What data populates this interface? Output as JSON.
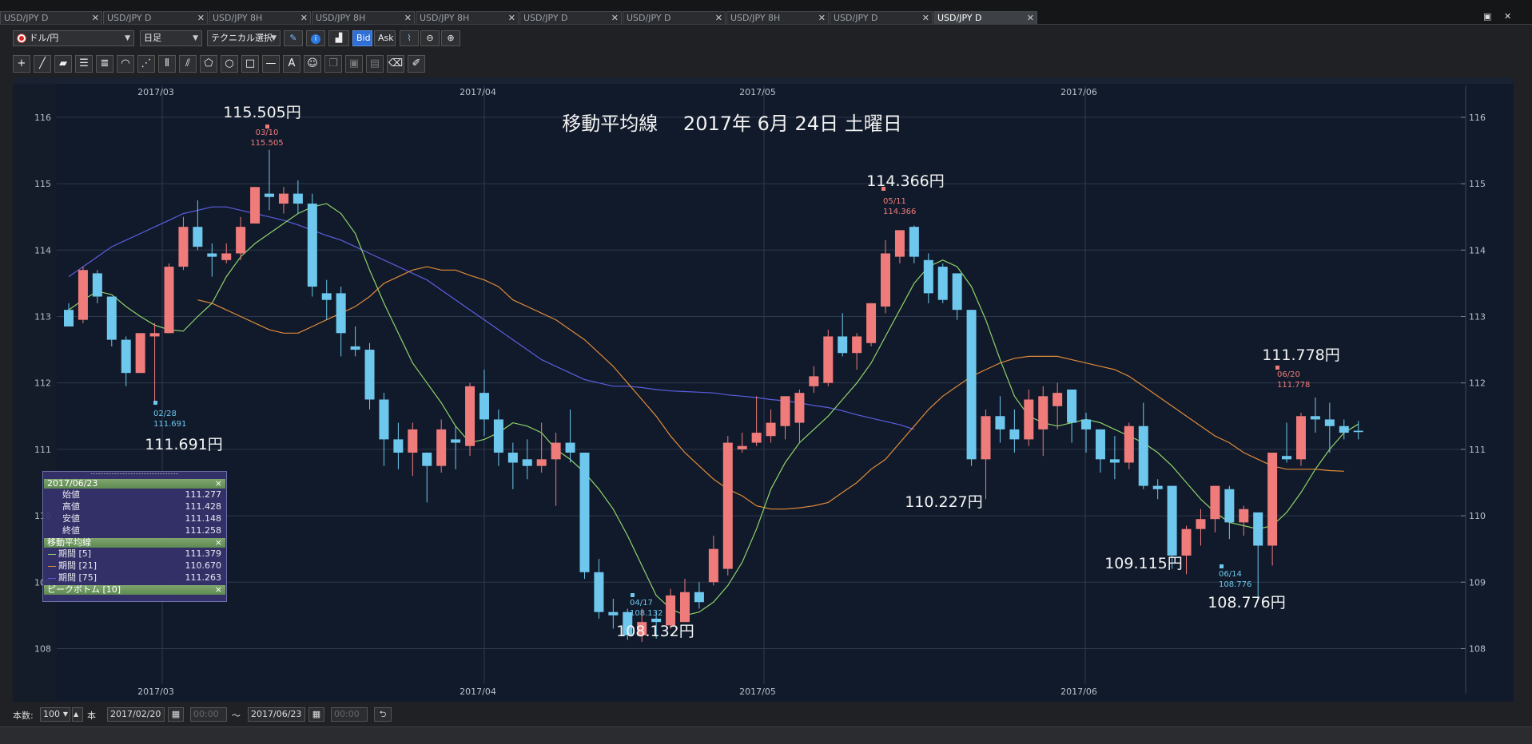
{
  "tabs": [
    {
      "label": "USD/JPY D",
      "x": 0,
      "w": 128,
      "active": false
    },
    {
      "label": "USD/JPY D",
      "x": 129,
      "w": 131,
      "active": false
    },
    {
      "label": "USD/JPY 8H",
      "x": 261,
      "w": 128,
      "active": false
    },
    {
      "label": "USD/JPY 8H",
      "x": 390,
      "w": 129,
      "active": false
    },
    {
      "label": "USD/JPY 8H",
      "x": 520,
      "w": 129,
      "active": false
    },
    {
      "label": "USD/JPY D",
      "x": 650,
      "w": 128,
      "active": false
    },
    {
      "label": "USD/JPY D",
      "x": 779,
      "w": 129,
      "active": false
    },
    {
      "label": "USD/JPY 8H",
      "x": 909,
      "w": 128,
      "active": false
    },
    {
      "label": "USD/JPY D",
      "x": 1038,
      "w": 129,
      "active": false
    },
    {
      "label": "USD/JPY D",
      "x": 1168,
      "w": 130,
      "active": true
    }
  ],
  "toolbar": {
    "pair": "ドル/円",
    "timeframe": "日足",
    "technical": "テクニカル選択",
    "bid": "Bid",
    "ask": "Ask"
  },
  "chart": {
    "title": "移動平均線　 2017年 6月 24日 土曜日",
    "months": [
      {
        "label": "2017/03",
        "x": 187
      },
      {
        "label": "2017/04",
        "x": 590
      },
      {
        "label": "2017/05",
        "x": 940
      },
      {
        "label": "2017/06",
        "x": 1342
      }
    ],
    "yticks": [
      116,
      115,
      114,
      113,
      112,
      111,
      110,
      109,
      108
    ],
    "y_axis_range": [
      107.2,
      116.6
    ]
  },
  "chart_data": {
    "type": "candlestick",
    "title": "移動平均線　 2017年 6月 24日 土曜日",
    "x_range": [
      "2017/02/20",
      "2017/06/23"
    ],
    "y_axis_range": [
      107.2,
      116.6
    ],
    "candles": [
      [
        113.1,
        112.85,
        113.2,
        112.85
      ],
      [
        112.95,
        113.7,
        113.75,
        112.9
      ],
      [
        113.65,
        113.3,
        113.7,
        113.2
      ],
      [
        113.3,
        112.65,
        113.3,
        112.55
      ],
      [
        112.65,
        112.15,
        112.7,
        111.95
      ],
      [
        112.15,
        112.75,
        112.75,
        112.15
      ],
      [
        112.7,
        112.75,
        112.9,
        111.7
      ],
      [
        112.75,
        113.75,
        113.8,
        112.75
      ],
      [
        113.75,
        114.35,
        114.5,
        113.7
      ],
      [
        114.35,
        114.05,
        114.75,
        114.0
      ],
      [
        113.95,
        113.9,
        114.1,
        113.6
      ],
      [
        113.85,
        113.95,
        114.1,
        113.8
      ],
      [
        113.95,
        114.35,
        114.5,
        113.85
      ],
      [
        114.4,
        114.95,
        114.95,
        114.4
      ],
      [
        114.85,
        114.8,
        115.51,
        114.6
      ],
      [
        114.7,
        114.85,
        114.95,
        114.55
      ],
      [
        114.85,
        114.7,
        115.05,
        114.55
      ],
      [
        114.7,
        113.45,
        114.85,
        113.3
      ],
      [
        113.35,
        113.25,
        113.55,
        112.95
      ],
      [
        113.35,
        112.75,
        113.45,
        112.4
      ],
      [
        112.55,
        112.5,
        112.85,
        112.4
      ],
      [
        112.5,
        111.75,
        112.6,
        111.6
      ],
      [
        111.75,
        111.15,
        111.85,
        110.75
      ],
      [
        111.15,
        110.95,
        111.4,
        110.7
      ],
      [
        110.95,
        111.3,
        111.4,
        110.6
      ],
      [
        110.95,
        110.75,
        110.95,
        110.2
      ],
      [
        110.75,
        111.3,
        111.45,
        110.65
      ],
      [
        111.15,
        111.1,
        111.35,
        110.7
      ],
      [
        111.05,
        111.95,
        112.0,
        110.9
      ],
      [
        111.85,
        111.45,
        112.2,
        111.2
      ],
      [
        111.45,
        110.95,
        111.6,
        110.75
      ],
      [
        110.95,
        110.8,
        111.1,
        110.4
      ],
      [
        110.85,
        110.75,
        111.15,
        110.55
      ],
      [
        110.75,
        110.85,
        111.4,
        110.65
      ],
      [
        110.85,
        111.1,
        111.25,
        110.15
      ],
      [
        111.1,
        110.95,
        111.6,
        110.8
      ],
      [
        110.95,
        109.15,
        110.95,
        109.05
      ],
      [
        109.15,
        108.55,
        109.35,
        108.45
      ],
      [
        108.55,
        108.5,
        108.75,
        108.3
      ],
      [
        108.55,
        108.2,
        108.6,
        108.13
      ],
      [
        108.2,
        108.4,
        108.6,
        108.1
      ],
      [
        108.45,
        108.4,
        108.55,
        108.15
      ],
      [
        108.35,
        108.8,
        108.9,
        108.3
      ],
      [
        108.4,
        108.85,
        109.05,
        108.4
      ],
      [
        108.85,
        108.7,
        109.0,
        108.6
      ],
      [
        109.0,
        109.5,
        109.7,
        108.95
      ],
      [
        109.2,
        111.1,
        111.2,
        109.1
      ],
      [
        111.0,
        111.05,
        111.25,
        110.95
      ],
      [
        111.1,
        111.25,
        111.8,
        111.05
      ],
      [
        111.2,
        111.4,
        111.6,
        111.1
      ],
      [
        111.35,
        111.8,
        111.8,
        111.15
      ],
      [
        111.4,
        111.85,
        111.9,
        111.1
      ],
      [
        111.95,
        112.1,
        112.25,
        111.85
      ],
      [
        112.0,
        112.7,
        112.8,
        111.95
      ],
      [
        112.7,
        112.45,
        113.05,
        112.4
      ],
      [
        112.45,
        112.7,
        112.75,
        112.2
      ],
      [
        112.6,
        113.2,
        113.2,
        112.55
      ],
      [
        113.15,
        113.95,
        114.15,
        113.05
      ],
      [
        113.9,
        114.3,
        114.3,
        113.8
      ],
      [
        114.35,
        113.9,
        114.37,
        113.8
      ],
      [
        113.85,
        113.35,
        113.95,
        113.2
      ],
      [
        113.75,
        113.25,
        113.8,
        113.2
      ],
      [
        113.65,
        113.1,
        113.65,
        112.95
      ],
      [
        113.1,
        110.85,
        113.1,
        110.75
      ],
      [
        110.85,
        111.5,
        111.6,
        110.25
      ],
      [
        111.5,
        111.3,
        111.8,
        111.1
      ],
      [
        111.3,
        111.15,
        111.6,
        110.95
      ],
      [
        111.15,
        111.75,
        111.9,
        111.05
      ],
      [
        111.3,
        111.8,
        111.95,
        110.9
      ],
      [
        111.65,
        111.85,
        112.0,
        111.3
      ],
      [
        111.9,
        111.4,
        111.9,
        111.1
      ],
      [
        111.45,
        111.3,
        111.55,
        110.95
      ],
      [
        111.3,
        110.85,
        111.3,
        110.65
      ],
      [
        110.85,
        110.8,
        111.2,
        110.55
      ],
      [
        110.8,
        111.35,
        111.4,
        110.7
      ],
      [
        111.35,
        110.45,
        111.7,
        110.4
      ],
      [
        110.45,
        110.4,
        110.55,
        110.25
      ],
      [
        110.45,
        109.4,
        110.45,
        109.2
      ],
      [
        109.4,
        109.8,
        109.85,
        109.12
      ],
      [
        109.8,
        109.95,
        110.1,
        109.55
      ],
      [
        109.95,
        110.45,
        110.45,
        109.75
      ],
      [
        110.4,
        109.9,
        110.45,
        109.65
      ],
      [
        109.9,
        110.1,
        110.15,
        109.7
      ],
      [
        110.05,
        109.55,
        110.05,
        108.78
      ],
      [
        109.55,
        110.95,
        110.95,
        109.25
      ],
      [
        110.9,
        110.85,
        111.4,
        110.8
      ],
      [
        110.85,
        111.5,
        111.55,
        110.75
      ],
      [
        111.5,
        111.45,
        111.78,
        111.25
      ],
      [
        111.45,
        111.35,
        111.7,
        110.95
      ],
      [
        111.35,
        111.25,
        111.45,
        111.15
      ],
      [
        111.28,
        111.26,
        111.43,
        111.15
      ]
    ],
    "ma5": [
      113.1,
      113.25,
      113.38,
      113.33,
      113.15,
      113.0,
      112.87,
      112.8,
      112.78,
      113.0,
      113.2,
      113.6,
      113.9,
      114.1,
      114.25,
      114.4,
      114.55,
      114.65,
      114.7,
      114.55,
      114.25,
      113.7,
      113.2,
      112.75,
      112.3,
      112.0,
      111.7,
      111.35,
      111.1,
      111.15,
      111.25,
      111.4,
      111.35,
      111.25,
      111.0,
      110.85,
      110.65,
      110.4,
      110.1,
      109.7,
      109.25,
      108.8,
      108.6,
      108.5,
      108.55,
      108.7,
      108.95,
      109.3,
      109.8,
      110.4,
      110.8,
      111.1,
      111.3,
      111.5,
      111.75,
      112.0,
      112.3,
      112.7,
      113.1,
      113.5,
      113.75,
      113.85,
      113.75,
      113.45,
      112.95,
      112.35,
      111.8,
      111.5,
      111.4,
      111.35,
      111.4,
      111.45,
      111.4,
      111.3,
      111.2,
      111.1,
      110.95,
      110.75,
      110.5,
      110.25,
      110.05,
      109.9,
      109.85,
      109.8,
      109.85,
      110.05,
      110.35,
      110.7,
      111.0,
      111.25,
      111.38
    ],
    "ma21": [
      113.25,
      113.2,
      113.1,
      113.0,
      112.9,
      112.8,
      112.75,
      112.75,
      112.85,
      112.95,
      113.05,
      113.15,
      113.3,
      113.5,
      113.6,
      113.7,
      113.75,
      113.7,
      113.7,
      113.62,
      113.55,
      113.45,
      113.25,
      113.15,
      113.05,
      112.95,
      112.8,
      112.65,
      112.45,
      112.25,
      112.0,
      111.75,
      111.5,
      111.2,
      110.95,
      110.75,
      110.55,
      110.4,
      110.3,
      110.15,
      110.1,
      110.1,
      110.12,
      110.15,
      110.2,
      110.35,
      110.5,
      110.7,
      110.85,
      111.1,
      111.35,
      111.6,
      111.8,
      111.95,
      112.1,
      112.2,
      112.3,
      112.37,
      112.4,
      112.4,
      112.4,
      112.35,
      112.3,
      112.25,
      112.2,
      112.1,
      111.95,
      111.8,
      111.65,
      111.5,
      111.35,
      111.2,
      111.1,
      110.95,
      110.85,
      110.75,
      110.7,
      110.7,
      110.7,
      110.68,
      110.67
    ],
    "ma75": [
      113.6,
      113.75,
      113.9,
      114.05,
      114.15,
      114.25,
      114.35,
      114.45,
      114.55,
      114.6,
      114.65,
      114.65,
      114.6,
      114.55,
      114.5,
      114.45,
      114.38,
      114.3,
      114.22,
      114.15,
      114.05,
      113.95,
      113.85,
      113.75,
      113.65,
      113.55,
      113.4,
      113.25,
      113.1,
      112.95,
      112.8,
      112.65,
      112.5,
      112.35,
      112.25,
      112.15,
      112.05,
      112.0,
      111.95,
      111.95,
      111.93,
      111.9,
      111.88,
      111.87,
      111.86,
      111.85,
      111.82,
      111.8,
      111.78,
      111.75,
      111.73,
      111.7,
      111.66,
      111.63,
      111.58,
      111.52,
      111.47,
      111.42,
      111.37,
      111.3
    ],
    "peaks": [
      {
        "date": "03/10",
        "value": "115.505",
        "label": "115.505円",
        "type": "high"
      },
      {
        "date": "02/28",
        "value": "111.691",
        "label": "111.691円",
        "type": "low"
      },
      {
        "date": "04/17",
        "value": "108.132",
        "label": "108.132円",
        "type": "low"
      },
      {
        "date": "05/11",
        "value": "114.366",
        "label": "114.366円",
        "type": "high"
      },
      {
        "date": "",
        "value": "",
        "label": "110.227円",
        "type": "low"
      },
      {
        "date": "",
        "value": "",
        "label": "109.115円",
        "type": "low"
      },
      {
        "date": "06/14",
        "value": "108.776",
        "label": "108.776円",
        "type": "low"
      },
      {
        "date": "06/20",
        "value": "111.778",
        "label": "111.778円",
        "type": "high"
      }
    ],
    "colors": {
      "up": "#f07b7b",
      "down": "#6ec8ee",
      "ma5": "#8fd36b",
      "ma21": "#e08a3a",
      "ma75": "#5a5ee0",
      "grid": "#2e394d",
      "bg": "#111a2a"
    }
  },
  "info": {
    "date": "2017/06/23",
    "ohlc": [
      {
        "label": "始値",
        "value": "111.277"
      },
      {
        "label": "高値",
        "value": "111.428"
      },
      {
        "label": "安値",
        "value": "111.148"
      },
      {
        "label": "終値",
        "value": "111.258"
      }
    ],
    "ma_title": "移動平均線",
    "ma": [
      {
        "label": "期間 [5]",
        "value": "111.379",
        "color": "#8fd36b"
      },
      {
        "label": "期間 [21]",
        "value": "110.670",
        "color": "#e08a3a"
      },
      {
        "label": "期間 [75]",
        "value": "111.263",
        "color": "#5a5ee0"
      }
    ],
    "peak_title": "ピークボトム [10]"
  },
  "status": {
    "count_label": "本数:",
    "count": "100",
    "unit": "本",
    "start_date": "2017/02/20",
    "start_time": "00:00",
    "tilde": "〜",
    "end_date": "2017/06/23",
    "end_time": "00:00"
  }
}
